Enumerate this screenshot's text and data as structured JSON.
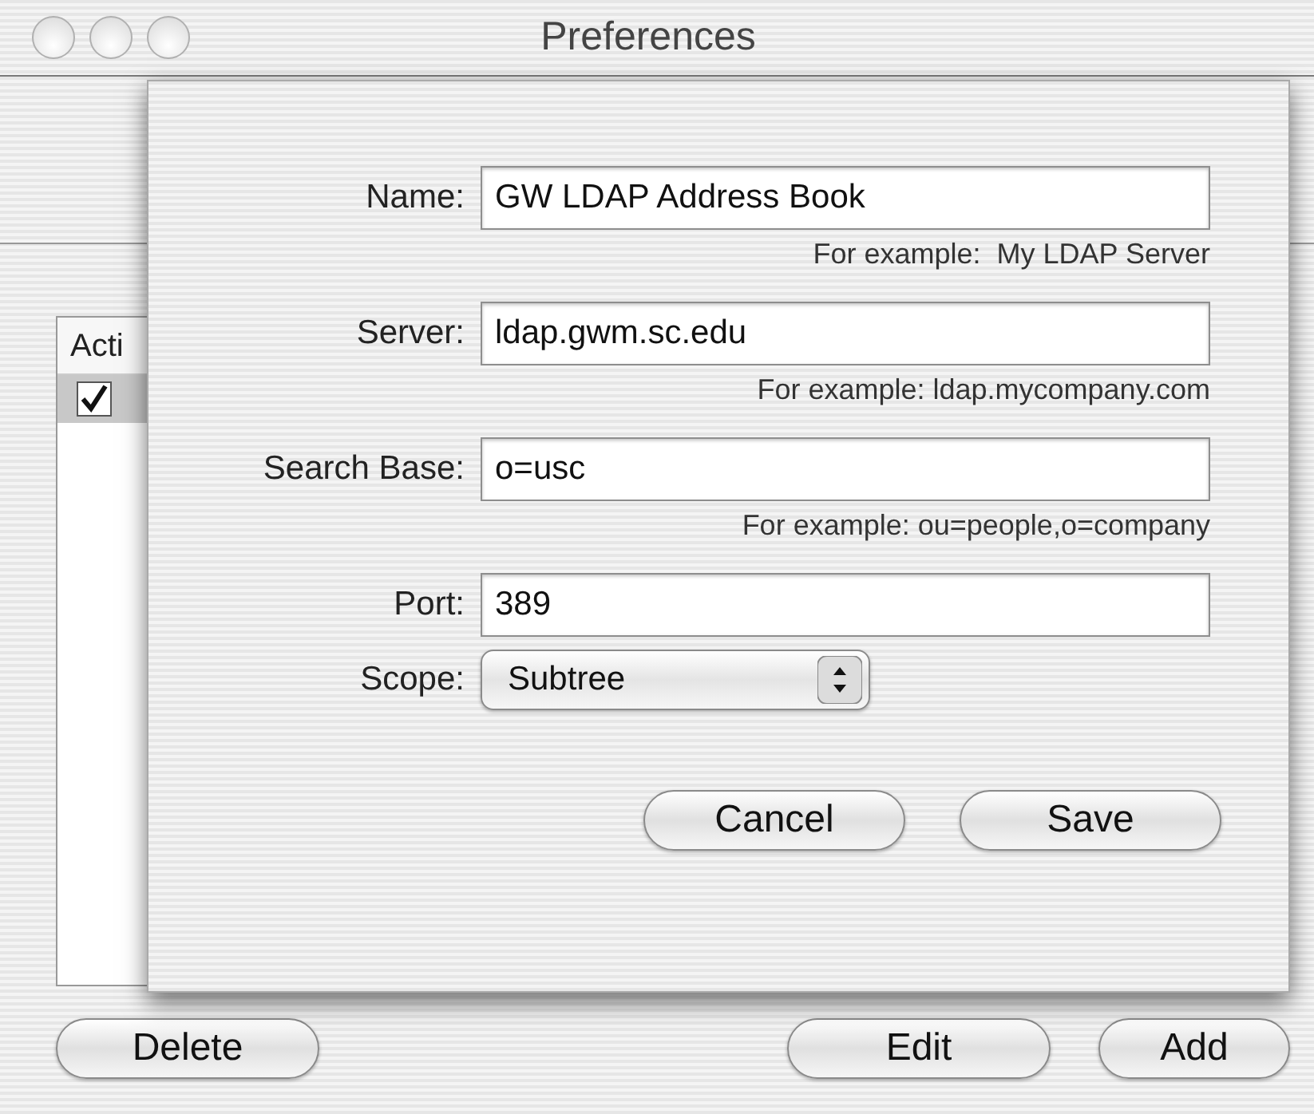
{
  "window": {
    "title": "Preferences"
  },
  "table": {
    "columns": [
      "Acti"
    ],
    "rows": [
      {
        "checked": true,
        "selected": true
      }
    ]
  },
  "buttons": [
    "Delete",
    "Edit",
    "Add"
  ],
  "sheet": {
    "fields": [
      {
        "kind": "text",
        "label": "Name:",
        "value": "GW LDAP Address Book",
        "hint": "For example:  My LDAP Server"
      },
      {
        "kind": "text",
        "label": "Server:",
        "value": "ldap.gwm.sc.edu",
        "hint": "For example: ldap.mycompany.com"
      },
      {
        "kind": "text",
        "label": "Search Base:",
        "value": "o=usc",
        "hint": "For example: ou=people,o=company"
      },
      {
        "kind": "text",
        "label": "Port:",
        "value": "389"
      },
      {
        "kind": "popup",
        "label": "Scope:",
        "value": "Subtree"
      }
    ],
    "buttons": [
      "Cancel",
      "Save"
    ]
  }
}
